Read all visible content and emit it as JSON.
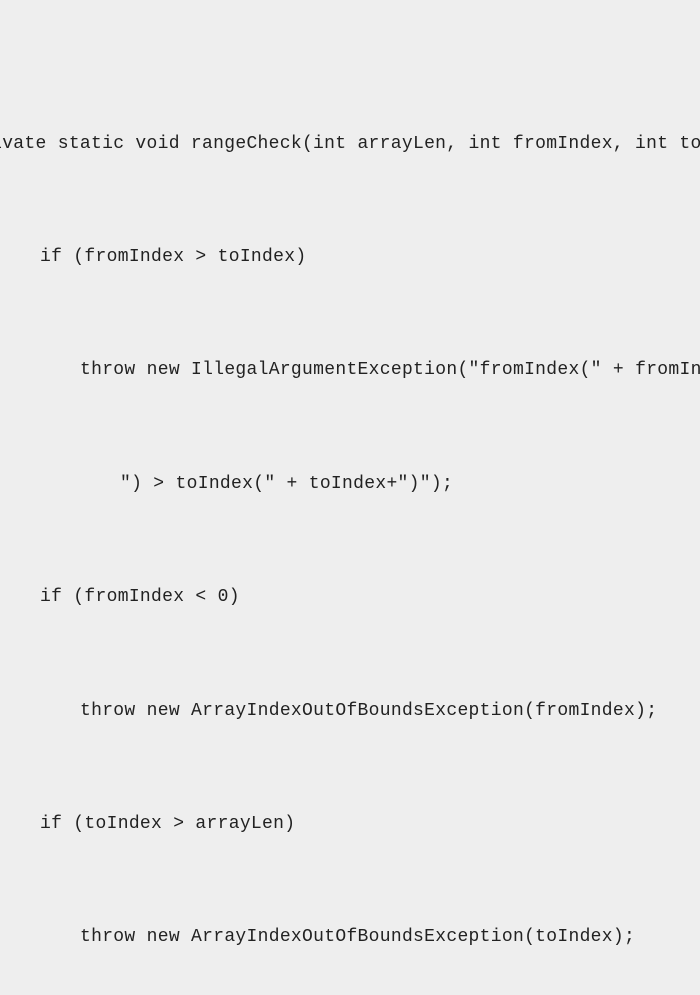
{
  "code": {
    "line1": "rivate static void rangeCheck(int arrayLen, int fromIndex, int toInde",
    "line2": "if (fromIndex > toIndex)",
    "line3": "throw new IllegalArgumentException(\"fromIndex(\" + fromIndex ",
    "line4": "\") > toIndex(\" + toIndex+\")\");",
    "line5": "if (fromIndex < 0)",
    "line6": "throw new ArrayIndexOutOfBoundsException(fromIndex);",
    "line7": "if (toIndex > arrayLen)",
    "line8": "throw new ArrayIndexOutOfBoundsException(toIndex);"
  }
}
